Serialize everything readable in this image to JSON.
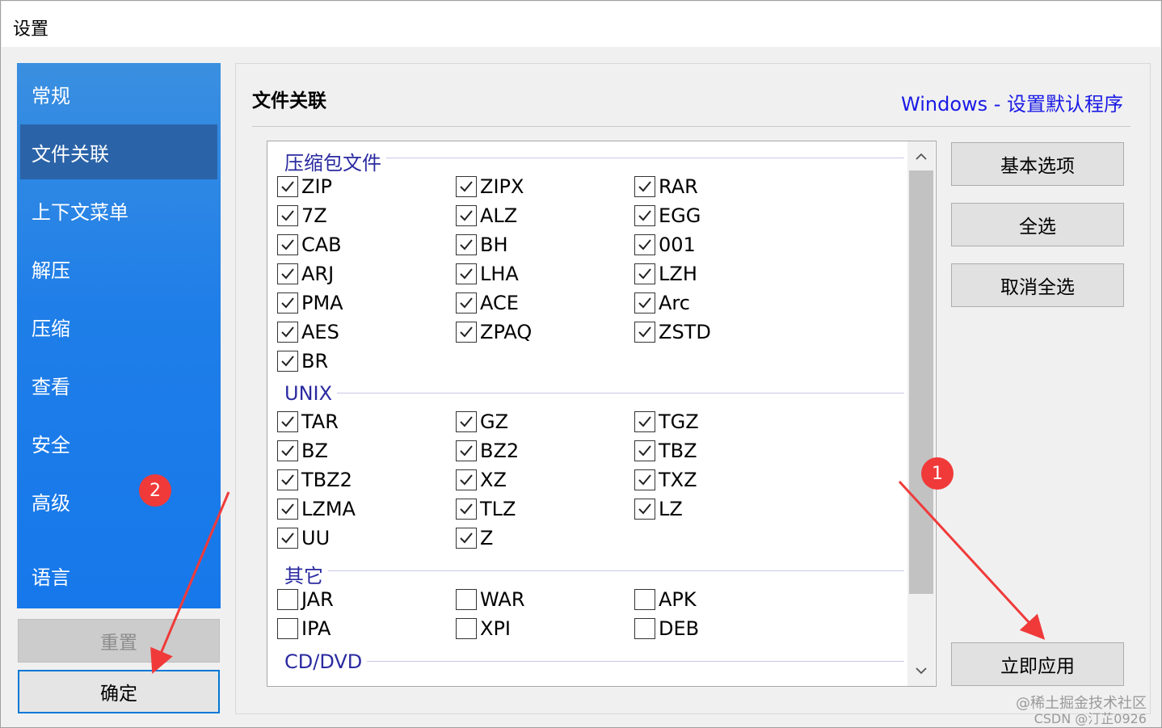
{
  "window": {
    "title": "设置"
  },
  "sidebar": {
    "items": [
      {
        "label": "常规",
        "active": false
      },
      {
        "label": "文件关联",
        "active": true
      },
      {
        "label": "上下文菜单",
        "active": false
      },
      {
        "label": "解压",
        "active": false
      },
      {
        "label": "压缩",
        "active": false
      },
      {
        "label": "查看",
        "active": false
      },
      {
        "label": "安全",
        "active": false
      },
      {
        "label": "高级",
        "active": false
      },
      {
        "label": "语言",
        "active": false
      }
    ],
    "reset_label": "重置",
    "ok_label": "确定"
  },
  "panel": {
    "title": "文件关联",
    "link": "Windows - 设置默认程序",
    "groups": [
      {
        "name": "压缩包文件",
        "items": [
          {
            "label": "ZIP",
            "checked": true
          },
          {
            "label": "ZIPX",
            "checked": true
          },
          {
            "label": "RAR",
            "checked": true
          },
          {
            "label": "7Z",
            "checked": true
          },
          {
            "label": "ALZ",
            "checked": true
          },
          {
            "label": "EGG",
            "checked": true
          },
          {
            "label": "CAB",
            "checked": true
          },
          {
            "label": "BH",
            "checked": true
          },
          {
            "label": "001",
            "checked": true
          },
          {
            "label": "ARJ",
            "checked": true
          },
          {
            "label": "LHA",
            "checked": true
          },
          {
            "label": "LZH",
            "checked": true
          },
          {
            "label": "PMA",
            "checked": true
          },
          {
            "label": "ACE",
            "checked": true
          },
          {
            "label": "Arc",
            "checked": true
          },
          {
            "label": "AES",
            "checked": true
          },
          {
            "label": "ZPAQ",
            "checked": true
          },
          {
            "label": "ZSTD",
            "checked": true
          },
          {
            "label": "BR",
            "checked": true
          }
        ]
      },
      {
        "name": "UNIX",
        "items": [
          {
            "label": "TAR",
            "checked": true
          },
          {
            "label": "GZ",
            "checked": true
          },
          {
            "label": "TGZ",
            "checked": true
          },
          {
            "label": "BZ",
            "checked": true
          },
          {
            "label": "BZ2",
            "checked": true
          },
          {
            "label": "TBZ",
            "checked": true
          },
          {
            "label": "TBZ2",
            "checked": true
          },
          {
            "label": "XZ",
            "checked": true
          },
          {
            "label": "TXZ",
            "checked": true
          },
          {
            "label": "LZMA",
            "checked": true
          },
          {
            "label": "TLZ",
            "checked": true
          },
          {
            "label": "LZ",
            "checked": true
          },
          {
            "label": "UU",
            "checked": true
          },
          {
            "label": "Z",
            "checked": true
          }
        ]
      },
      {
        "name": "其它",
        "items": [
          {
            "label": "JAR",
            "checked": false
          },
          {
            "label": "WAR",
            "checked": false
          },
          {
            "label": "APK",
            "checked": false
          },
          {
            "label": "IPA",
            "checked": false
          },
          {
            "label": "XPI",
            "checked": false
          },
          {
            "label": "DEB",
            "checked": false
          }
        ]
      },
      {
        "name": "CD/DVD",
        "items": []
      }
    ]
  },
  "right_buttons": {
    "basic": "基本选项",
    "select_all": "全选",
    "deselect_all": "取消全选",
    "apply": "立即应用"
  },
  "annotations": {
    "badge1": "1",
    "badge2": "2",
    "color": "#f03a3a"
  },
  "watermark": {
    "line1": "@稀土掘金技术社区",
    "line2": "CSDN @汀芷0926"
  },
  "icons": {
    "scroll_up": "chevron-up-icon",
    "scroll_down": "chevron-down-icon",
    "check": "check-icon"
  }
}
